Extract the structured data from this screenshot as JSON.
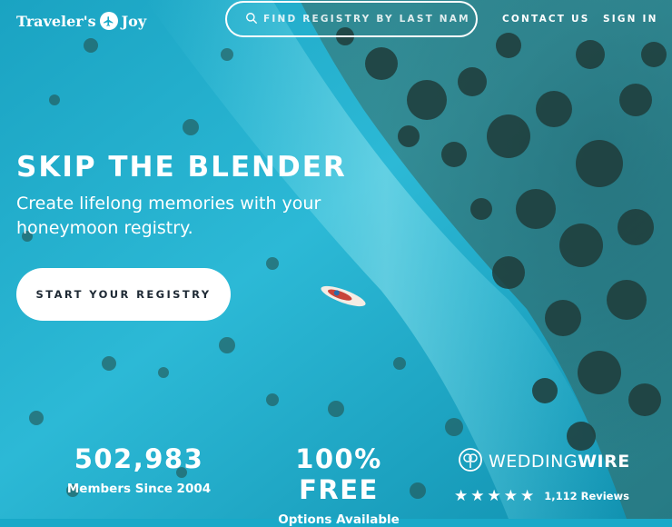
{
  "header": {
    "logo_left": "Traveler's",
    "logo_right": "Joy",
    "search_placeholder": "FIND REGISTRY BY LAST NAME",
    "contact_label": "CONTACT US",
    "signin_label": "SIGN IN"
  },
  "hero": {
    "title": "SKIP THE BLENDER",
    "subtitle": "Create lifelong memories with your honeymoon registry.",
    "cta_label": "START YOUR REGISTRY"
  },
  "stats": [
    {
      "value": "502,983",
      "label": "Members Since 2004"
    },
    {
      "value": "100% FREE",
      "label": "Options Available"
    }
  ],
  "badge": {
    "brand_light": "WEDDING",
    "brand_bold": "WIRE",
    "stars": "★★★★★",
    "reviews": "1,112 Reviews"
  },
  "colors": {
    "water_light": "#3cc4dc",
    "water_deep": "#0d8fb0",
    "reef": "#1d3c3a",
    "cta_text": "#1f2a35"
  },
  "icons": [
    "airplane-icon",
    "search-icon",
    "wedding-rings-icon",
    "star-icon"
  ]
}
